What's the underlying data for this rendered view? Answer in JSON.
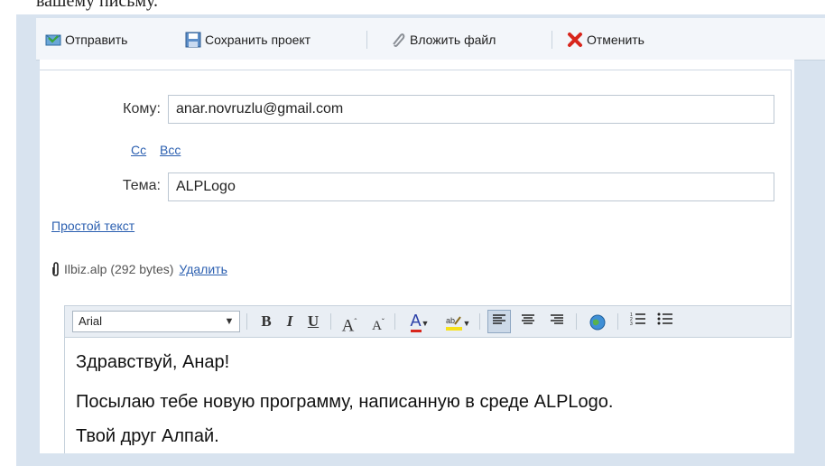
{
  "top_text": "вашему письму.",
  "toolbar": {
    "send_label": "Отправить",
    "save_label": "Сохранить проект",
    "attach_label": "Вложить файл",
    "cancel_label": "Отменить"
  },
  "form": {
    "to_label": "Кому:",
    "to_value": "anar.novruzlu@gmail.com",
    "cc_label": "Cc",
    "bcc_label": "Bcc",
    "subject_label": "Тема:",
    "subject_value": "ALPLogo",
    "plain_text_link": "Простой текст",
    "attachment": {
      "name": "Ilbiz.alp (292 bytes)",
      "delete_label": "Удалить"
    }
  },
  "editor_toolbar": {
    "font": "Arial",
    "bold": "B",
    "italic": "I",
    "underline": "U",
    "grow": "A",
    "shrink": "A",
    "font_color": "A"
  },
  "body": {
    "line1": "Здравствуй, Анар!",
    "line2": "Посылаю тебе новую программу, написанную в среде ALPLogo.",
    "line3": "Твой друг  Алпай."
  },
  "colors": {
    "accent": "#2b5fb0",
    "panel_bg": "#d8e3ef",
    "toolbar_bg": "#f3f6fa",
    "cancel_red": "#d8261c"
  }
}
